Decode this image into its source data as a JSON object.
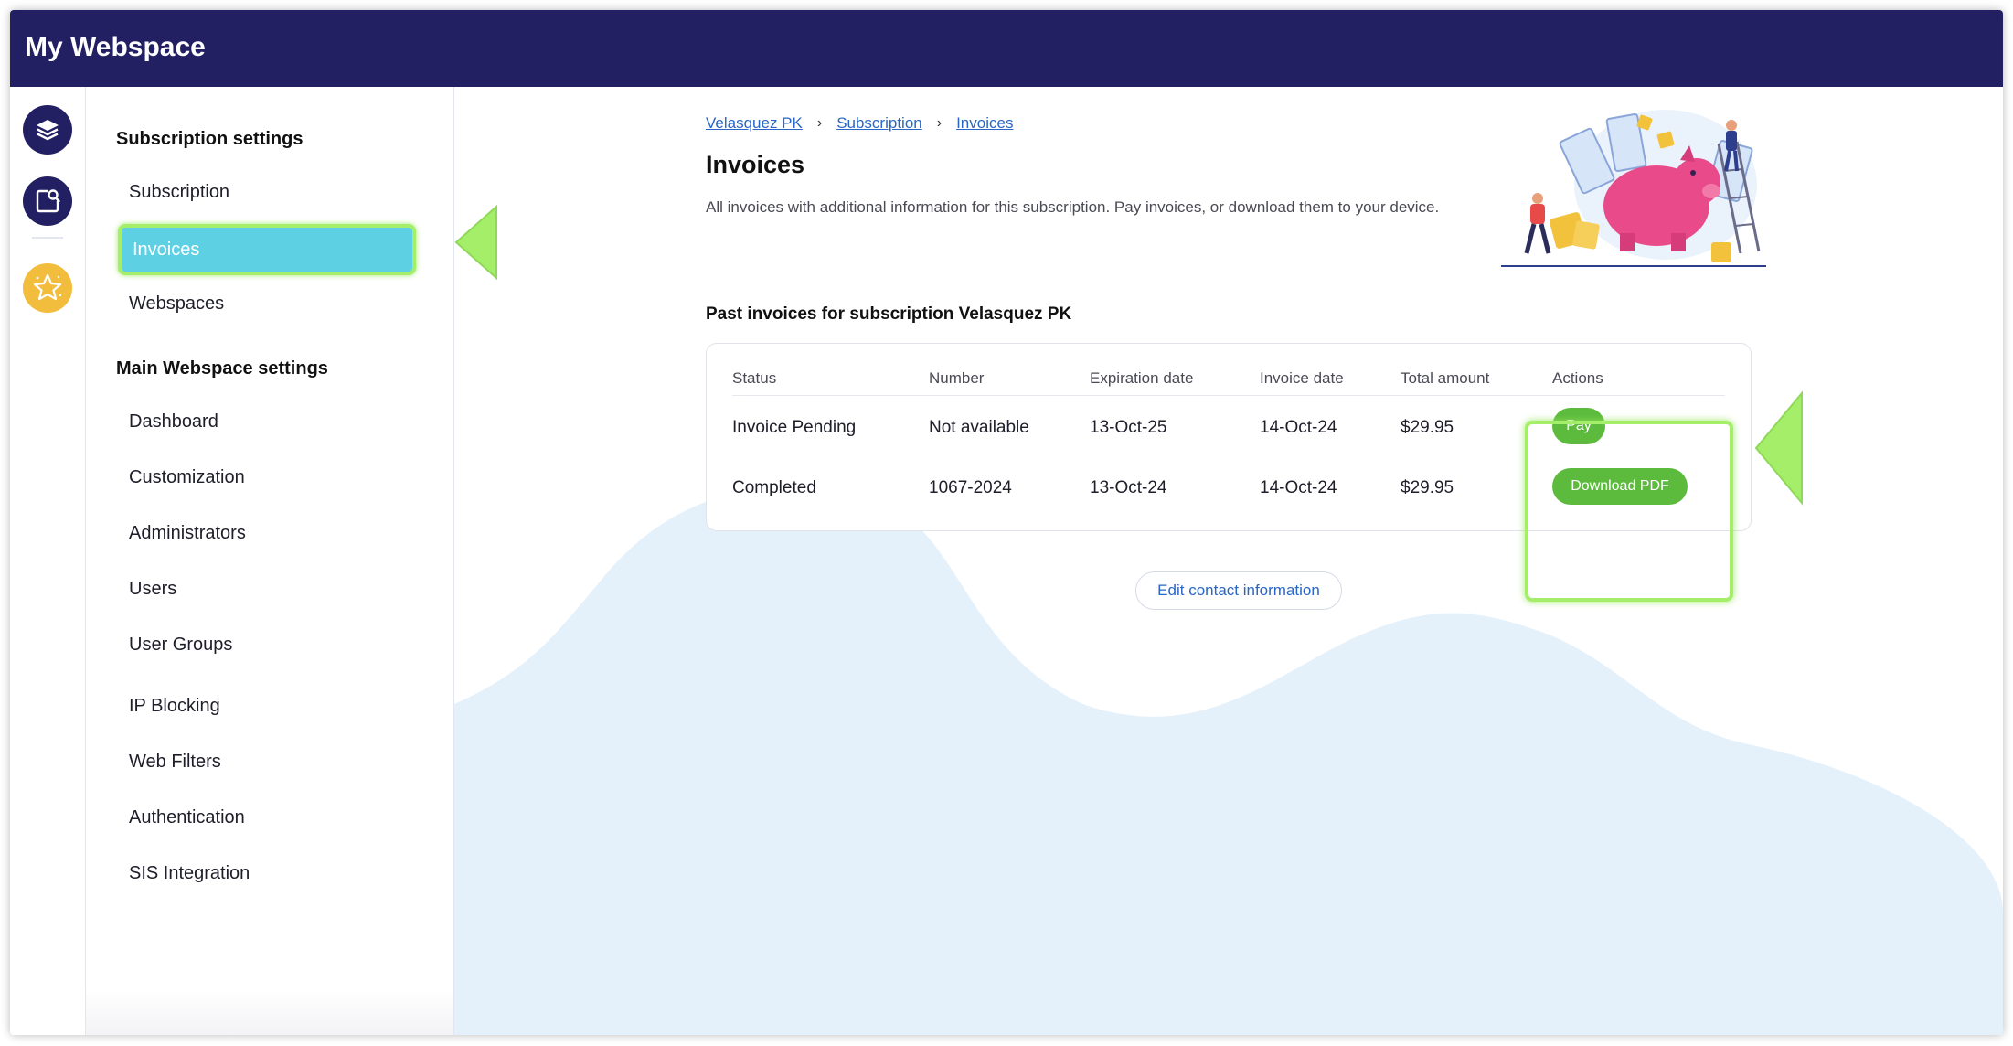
{
  "app": {
    "title": "My Webspace"
  },
  "rail": {
    "items": [
      {
        "icon": "layers-icon"
      },
      {
        "icon": "search-document-icon"
      },
      {
        "icon": "star-badge-icon"
      }
    ]
  },
  "sidebar": {
    "sections": [
      {
        "title": "Subscription settings",
        "items": [
          "Subscription",
          "Invoices",
          "Webspaces"
        ]
      },
      {
        "title": "Main Webspace settings",
        "items": [
          "Dashboard",
          "Customization",
          "Administrators",
          "Users",
          "User Groups",
          "IP Blocking",
          "Web Filters",
          "Authentication",
          "SIS Integration"
        ]
      }
    ],
    "active_item": "Invoices"
  },
  "breadcrumb": [
    "Velasquez PK",
    "Subscription",
    "Invoices"
  ],
  "page": {
    "title": "Invoices",
    "description": "All invoices with additional information for this subscription. Pay invoices, or download them to your device.",
    "past_title": "Past invoices for subscription Velasquez PK"
  },
  "table": {
    "headers": [
      "Status",
      "Number",
      "Expiration date",
      "Invoice date",
      "Total amount",
      "Actions"
    ],
    "rows": [
      {
        "status": "Invoice Pending",
        "number": "Not available",
        "expiration": "13-Oct-25",
        "invoice_date": "14-Oct-24",
        "total": "$29.95",
        "action": "Pay"
      },
      {
        "status": "Completed",
        "number": "1067-2024",
        "expiration": "13-Oct-24",
        "invoice_date": "14-Oct-24",
        "total": "$29.95",
        "action": "Download PDF"
      }
    ]
  },
  "edit_contact": "Edit contact information",
  "colors": {
    "header": "#222063",
    "active_nav": "#5dd0e4",
    "highlight": "#a4ee6a",
    "action_button": "#5cba3c",
    "link": "#2a66c6",
    "blob": "#e4f1fb"
  }
}
